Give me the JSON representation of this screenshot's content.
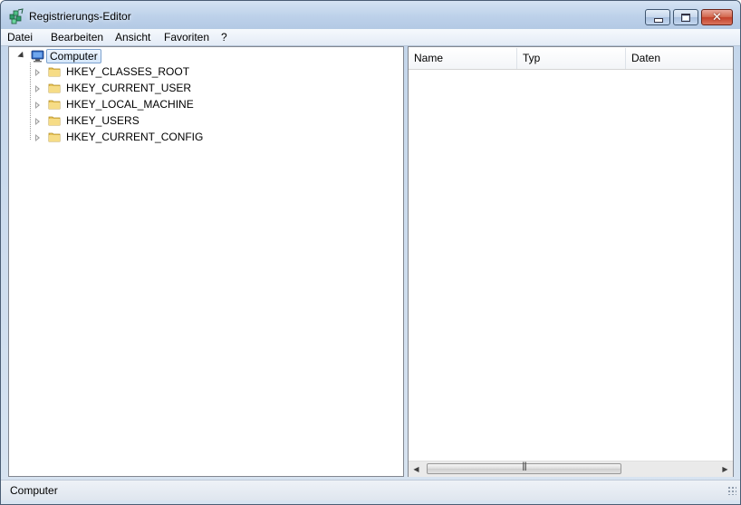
{
  "window": {
    "title": "Registrierungs-Editor",
    "close_glyph": "✕"
  },
  "menu": [
    "Datei",
    "Bearbeiten",
    "Ansicht",
    "Favoriten",
    "?"
  ],
  "tree": {
    "root": "Computer",
    "nodes": [
      "HKEY_CLASSES_ROOT",
      "HKEY_CURRENT_USER",
      "HKEY_LOCAL_MACHINE",
      "HKEY_USERS",
      "HKEY_CURRENT_CONFIG"
    ]
  },
  "list": {
    "columns": [
      "Name",
      "Typ",
      "Daten"
    ]
  },
  "scrollbar": {
    "left_arrow": "◀",
    "right_arrow": "▶",
    "grip": "|||"
  },
  "status": {
    "text": "Computer"
  },
  "icons": {
    "app": "registry-editor-icon",
    "computer": "computer-icon",
    "folder": "folder-icon"
  },
  "colors": {
    "titlebar": "#bdd1ea",
    "selection_border": "#7da2ce",
    "folder": "#e8c45a"
  }
}
